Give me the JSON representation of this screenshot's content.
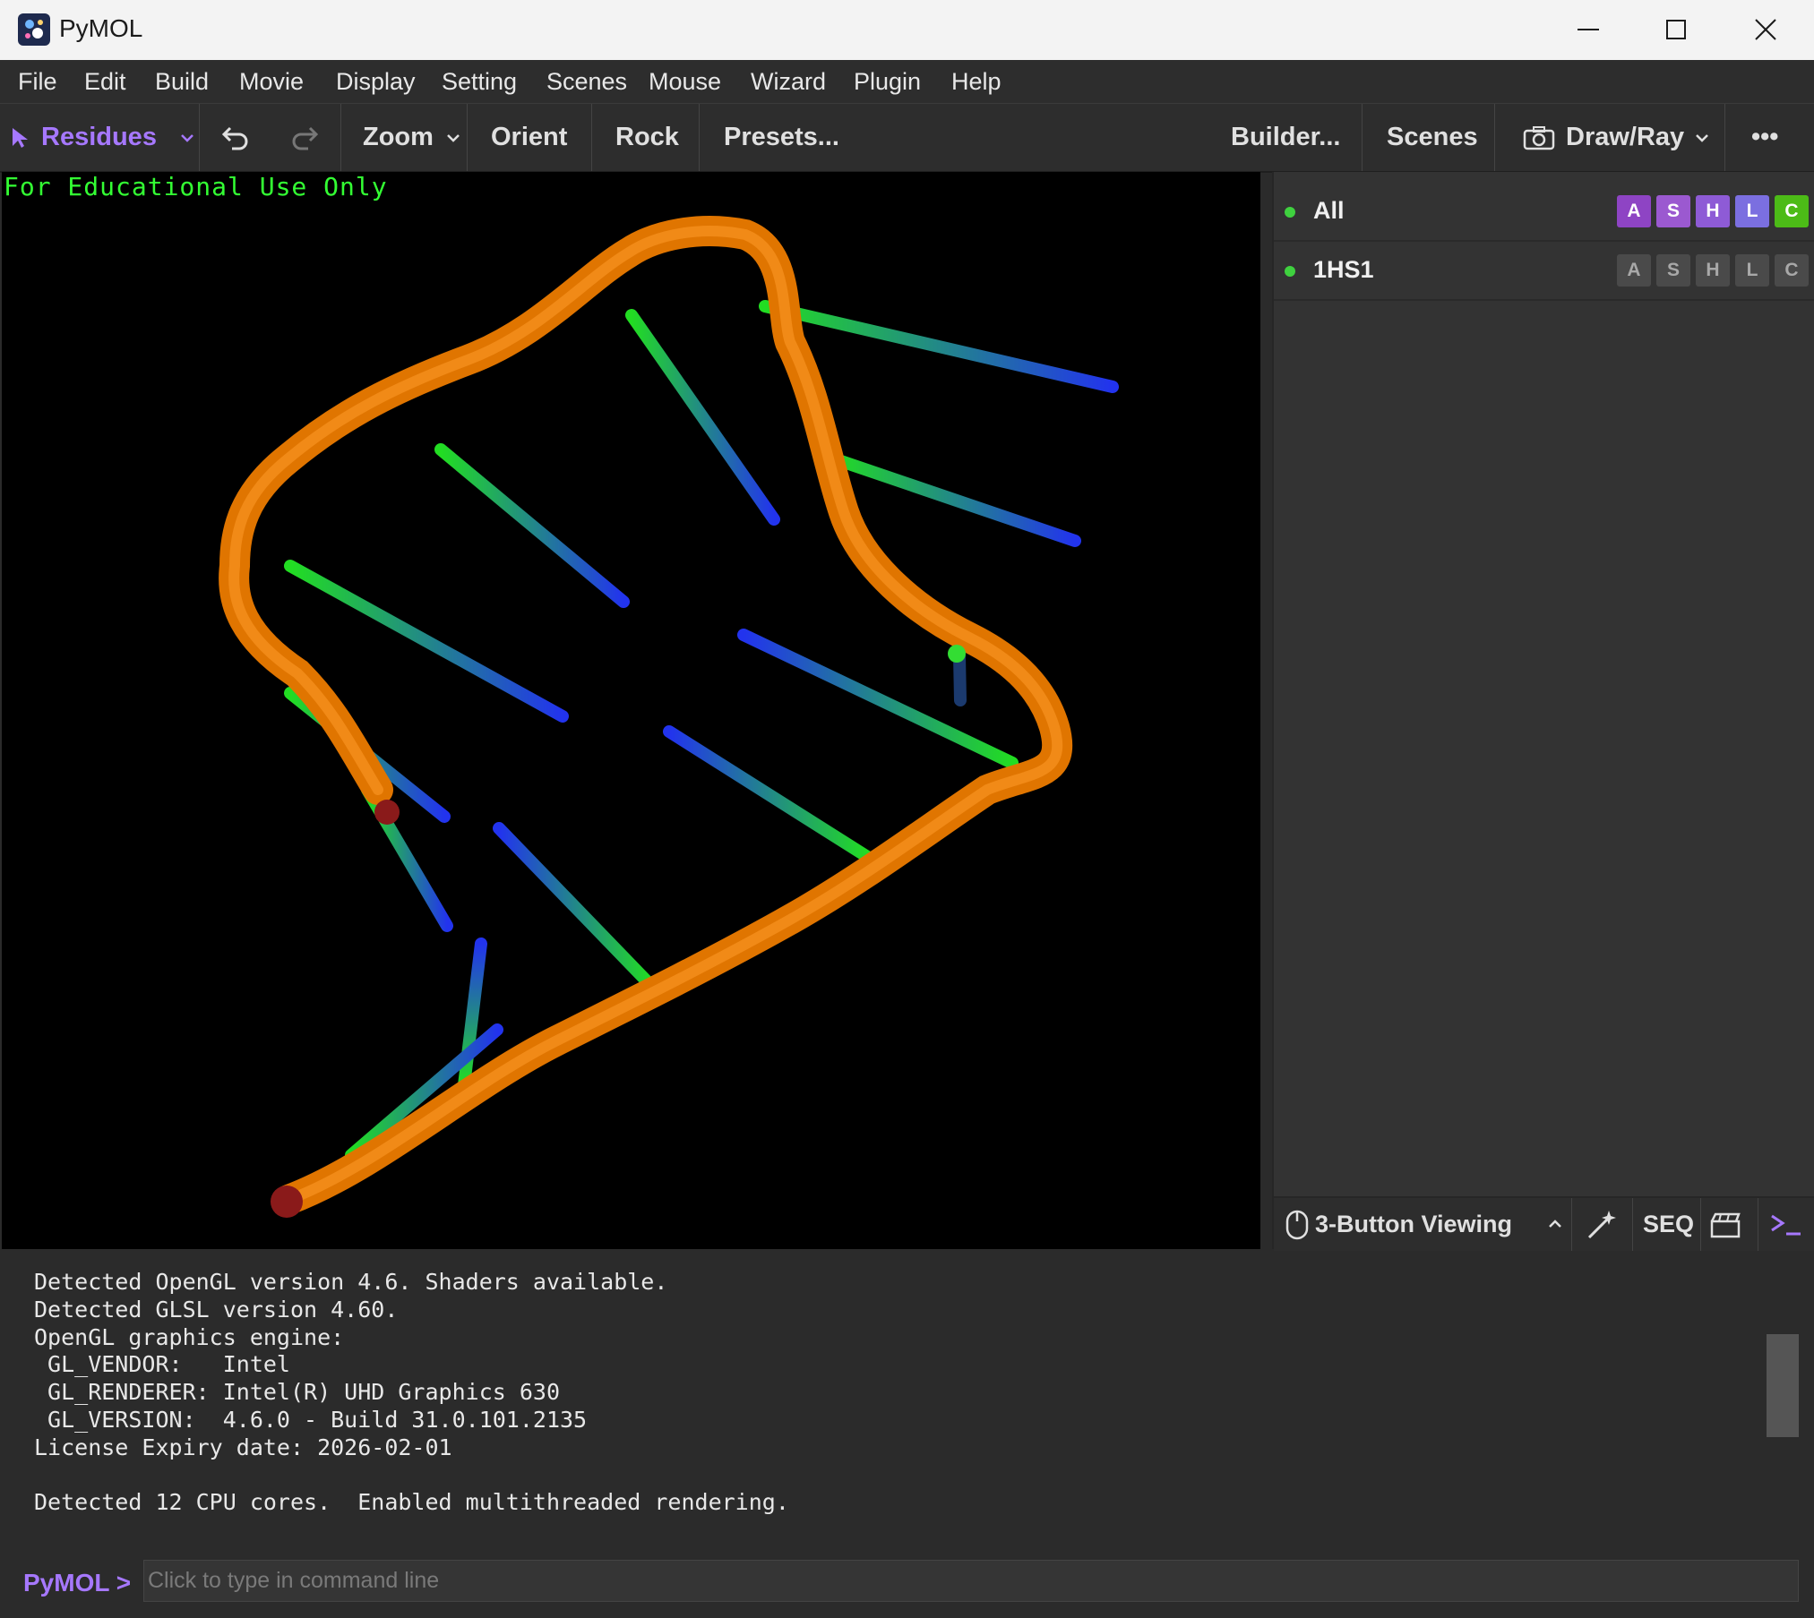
{
  "window": {
    "title": "PyMOL"
  },
  "menu": [
    "File",
    "Edit",
    "Build",
    "Movie",
    "Display",
    "Setting",
    "Scenes",
    "Mouse",
    "Wizard",
    "Plugin",
    "Help"
  ],
  "toolbar": {
    "selection_mode": "Residues",
    "zoom": "Zoom",
    "orient": "Orient",
    "rock": "Rock",
    "presets": "Presets...",
    "builder": "Builder...",
    "scenes": "Scenes",
    "draw_ray": "Draw/Ray",
    "more": "•••"
  },
  "viewport": {
    "watermark": "For Educational Use Only"
  },
  "objects": [
    {
      "name": "All",
      "buttons": [
        "A",
        "S",
        "H",
        "L",
        "C"
      ],
      "active": true
    },
    {
      "name": "1HS1",
      "buttons": [
        "A",
        "S",
        "H",
        "L",
        "C"
      ],
      "active": false
    }
  ],
  "panel_colors": {
    "A": "#8e44c4",
    "S": "#9b59d0",
    "H": "#8e5bd6",
    "L": "#7b6fe0",
    "C": "#4cbb17"
  },
  "bottom_bar": {
    "mouse_mode": "3-Button Viewing",
    "seq": "SEQ"
  },
  "console": {
    "lines": [
      "Detected OpenGL version 4.6. Shaders available.",
      "Detected GLSL version 4.60.",
      "OpenGL graphics engine:",
      " GL_VENDOR:   Intel",
      " GL_RENDERER: Intel(R) UHD Graphics 630",
      " GL_VERSION:  4.6.0 - Build 31.0.101.2135",
      "License Expiry date: 2026-02-01",
      "",
      "Detected 12 CPU cores.  Enabled multithreaded rendering."
    ]
  },
  "command": {
    "prompt": "PyMOL >",
    "placeholder": "Click to type in command line"
  }
}
